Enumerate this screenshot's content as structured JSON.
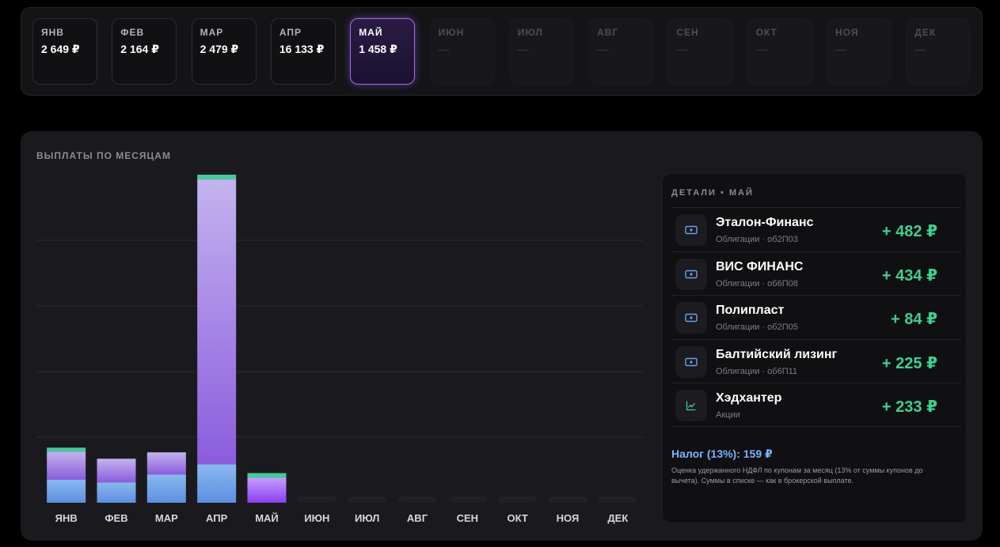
{
  "months_strip": [
    {
      "name": "ЯНВ",
      "amount": "2 649 ₽",
      "state": "filled"
    },
    {
      "name": "ФЕВ",
      "amount": "2 164 ₽",
      "state": "filled"
    },
    {
      "name": "МАР",
      "amount": "2 479 ₽",
      "state": "filled"
    },
    {
      "name": "АПР",
      "amount": "16 133 ₽",
      "state": "filled"
    },
    {
      "name": "МАЙ",
      "amount": "1 458 ₽",
      "state": "active"
    },
    {
      "name": "ИЮН",
      "amount": "—",
      "state": "empty"
    },
    {
      "name": "ИЮЛ",
      "amount": "—",
      "state": "empty"
    },
    {
      "name": "АВГ",
      "amount": "—",
      "state": "empty"
    },
    {
      "name": "СЕН",
      "amount": "—",
      "state": "empty"
    },
    {
      "name": "ОКТ",
      "amount": "—",
      "state": "empty"
    },
    {
      "name": "НОЯ",
      "amount": "—",
      "state": "empty"
    },
    {
      "name": "ДЕК",
      "amount": "—",
      "state": "empty"
    }
  ],
  "panel": {
    "title": "ВЫПЛАТЫ ПО МЕСЯЦАМ"
  },
  "chart_data": {
    "type": "bar",
    "stacked": true,
    "categories": [
      "ЯНВ",
      "ФЕВ",
      "МАР",
      "АПР",
      "МАЙ",
      "ИЮН",
      "ИЮЛ",
      "АВГ",
      "СЕН",
      "ОКТ",
      "НОЯ",
      "ДЕК"
    ],
    "series": [
      {
        "values": [
          1141,
          1005,
          1393,
          1892,
          0,
          0,
          0,
          0,
          0,
          0,
          0,
          0
        ],
        "color": "#6fa3ea"
      },
      {
        "values": [
          1373,
          1159,
          1086,
          14006,
          1225,
          0,
          0,
          0,
          0,
          0,
          0,
          0
        ],
        "color": "#a37ee6"
      },
      {
        "values": [
          135,
          0,
          0,
          235,
          233,
          0,
          0,
          0,
          0,
          0,
          0,
          0
        ],
        "color": "#47c99a"
      }
    ],
    "ylim": [
      0,
      16133
    ],
    "grid": true,
    "highlight_category": "МАЙ"
  },
  "details": {
    "title": "ДЕТАЛИ • МАЙ",
    "items": [
      {
        "name": "Эталон-Финанс",
        "sub": "Облигации · об2П03",
        "amount": "+ 482 ₽",
        "icon": "bond-icon"
      },
      {
        "name": "ВИС ФИНАНС",
        "sub": "Облигации · об6П08",
        "amount": "+ 434 ₽",
        "icon": "bond-icon"
      },
      {
        "name": "Полипласт",
        "sub": "Облигации · об2П05",
        "amount": "+ 84 ₽",
        "icon": "bond-icon"
      },
      {
        "name": "Балтийский лизинг",
        "sub": "Облигации · об6П11",
        "amount": "+ 225 ₽",
        "icon": "bond-icon"
      },
      {
        "name": "Хэдхантер",
        "sub": "Акции",
        "amount": "+ 233 ₽",
        "icon": "stock-chart-icon"
      }
    ],
    "tax_label": "Налог (13%): 159 ₽",
    "tax_note": "Оценка удержанного НДФЛ по купонам за месяц (13% от суммы купонов до вычета). Суммы в списке — как в брокерской выплате."
  },
  "colors": {
    "accent_purple": "#a86cf0",
    "income_green": "#3fcf8e",
    "tax_blue": "#7fb0ff"
  }
}
